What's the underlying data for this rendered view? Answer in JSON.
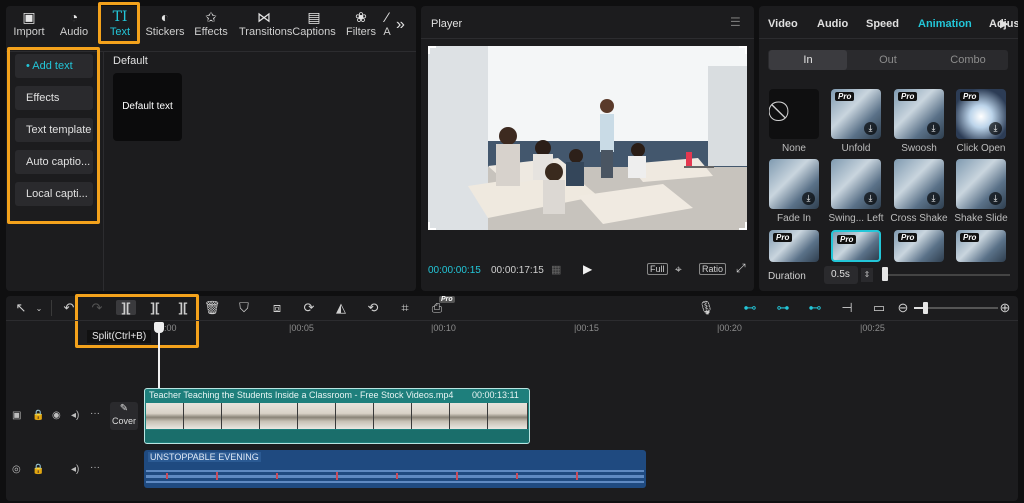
{
  "toolbar": {
    "tabs": [
      {
        "label": "Import",
        "icon": "import-icon"
      },
      {
        "label": "Audio",
        "icon": "audio-icon"
      },
      {
        "label": "Text",
        "icon": "text-icon",
        "glyph": "TI"
      },
      {
        "label": "Stickers",
        "icon": "stickers-icon"
      },
      {
        "label": "Effects",
        "icon": "effects-icon"
      },
      {
        "label": "Transitions",
        "icon": "transitions-icon"
      },
      {
        "label": "Captions",
        "icon": "captions-icon"
      },
      {
        "label": "Filters",
        "icon": "filters-icon"
      },
      {
        "label": "A",
        "icon": "adjust-icon"
      }
    ],
    "more": "»",
    "active": "Text"
  },
  "sidebar": {
    "items": [
      "• Add text",
      "Effects",
      "Text template",
      "Auto captio...",
      "Local capti..."
    ]
  },
  "library": {
    "section_label": "Default",
    "card_label": "Default text"
  },
  "player": {
    "title": "Player",
    "current_time": "00:00:00:15",
    "total_time": "00:00:17:15",
    "full_label": "Full",
    "ratio_label": "Ratio"
  },
  "inspector": {
    "tabs": [
      "Video",
      "Audio",
      "Speed",
      "Animation",
      "Adjus"
    ],
    "active_tab": "Animation",
    "segments": [
      "In",
      "Out",
      "Combo"
    ],
    "active_segment": "In",
    "animations": [
      {
        "label": "None"
      },
      {
        "label": "Unfold"
      },
      {
        "label": "Swoosh"
      },
      {
        "label": "Click Open"
      },
      {
        "label": "Fade In"
      },
      {
        "label": "Swing... Left"
      },
      {
        "label": "Cross Shake"
      },
      {
        "label": "Shake Slide"
      }
    ],
    "pro_badge": "Pro",
    "duration_label": "Duration",
    "duration_value": "0.5s"
  },
  "timeline": {
    "tooltip": "Split(Ctrl+B)",
    "ruler": [
      "00:00",
      "|00:05",
      "|00:10",
      "|00:15",
      "|00:20",
      "|00:25"
    ],
    "video_clip": {
      "title": "Teacher Teaching the Students Inside a Classroom - Free Stock Videos.mp4",
      "duration": "00:00:13:11"
    },
    "cover_label": "Cover",
    "audio_clip": {
      "title": "UNSTOPPABLE EVENING"
    },
    "pro_badge": "Pro"
  },
  "colors": {
    "accent": "#23c6d8",
    "highlight": "#f3a21c",
    "panel": "#1c1c1e",
    "video_track": "#1e7f7c",
    "audio_track": "#1f4a80"
  }
}
